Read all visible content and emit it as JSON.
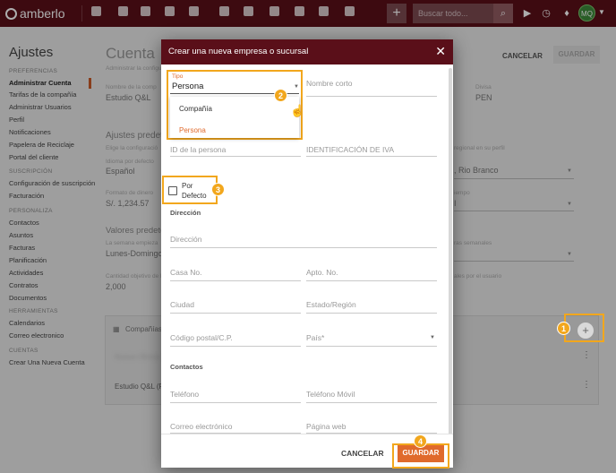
{
  "app": {
    "name": "amberlo"
  },
  "topbar": {
    "search_placeholder": "Buscar todo...",
    "avatar_initials": "MQ"
  },
  "sidebar": {
    "title": "Ajustes",
    "sections": [
      {
        "label": "PREFERENCIAS",
        "items": [
          "Administrar Cuenta",
          "Tarifas de la compañía",
          "Administrar Usuarios",
          "Perfil",
          "Notificaciones",
          "Papelera de Reciclaje",
          "Portal del cliente"
        ]
      },
      {
        "label": "SUSCRIPCIÓN",
        "items": [
          "Configuración de suscripción",
          "Facturación"
        ]
      },
      {
        "label": "PERSONALIZA",
        "items": [
          "Contactos",
          "Asuntos",
          "Facturas",
          "Planificación",
          "Actividades",
          "Contratos",
          "Documentos"
        ]
      },
      {
        "label": "HERRAMIENTAS",
        "items": [
          "Calendarios",
          "Correo electronico"
        ]
      },
      {
        "label": "CUENTAS",
        "items": [
          "Crear Una Nueva Cuenta"
        ]
      }
    ]
  },
  "background": {
    "page_title": "Cuenta",
    "subtitle": "Administrar la configu",
    "company_label": "Nombre de la comp",
    "company_value": "Estudio Q&L",
    "currency_label": "Divisa",
    "currency_value": "PEN",
    "cancel": "CANCELAR",
    "save": "GUARDAR",
    "defaults_title": "Ajustes predet",
    "defaults_desc": "Elige la configuració",
    "lang_label": "Idioma por defecto",
    "lang_value": "Español",
    "money_label": "Formato de dinero",
    "money_value": "S/. 1,234.57",
    "values_title": "Valores predeter",
    "week_label": "La semana empieza",
    "week_value": "Lunes-Domingo",
    "hours_label": "Cantidad objetivo de h",
    "hours_value": "2,000",
    "region_desc": "regional en su perfil",
    "tz_value": ", Rio Branco",
    "tz_label": "iempo",
    "tz_digit": "I",
    "weekly_label": "ras semanales",
    "user_label": "ales por el usuario",
    "companies_label": "Compañías",
    "company_row_blur": "Nueva Oficina",
    "company_row": "Estudio Q&L",
    "company_row_suffix": "(P"
  },
  "dialog": {
    "title": "Crear una nueva empresa o sucursal",
    "tipo_label": "Tipo",
    "tipo_value": "Persona",
    "tipo_options": [
      "Compañía",
      "Persona"
    ],
    "short_name": "Nombre corto",
    "person_id": "ID de la persona",
    "vat_id": "IDENTIFICACIÓN DE IVA",
    "default_label": "Por Defecto",
    "address_section": "Dirección",
    "address": "Dirección",
    "house_no": "Casa No.",
    "apt_no": "Apto. No.",
    "city": "Ciudad",
    "state": "Estado/Región",
    "zip": "Código postal/C.P.",
    "country": "País*",
    "contacts_section": "Contactos",
    "phone": "Teléfono",
    "mobile": "Teléfono Móvil",
    "email": "Correo electrónico",
    "website": "Página web",
    "cancel": "CANCELAR",
    "save": "GUARDAR"
  },
  "badges": [
    "1",
    "2",
    "3",
    "4"
  ]
}
